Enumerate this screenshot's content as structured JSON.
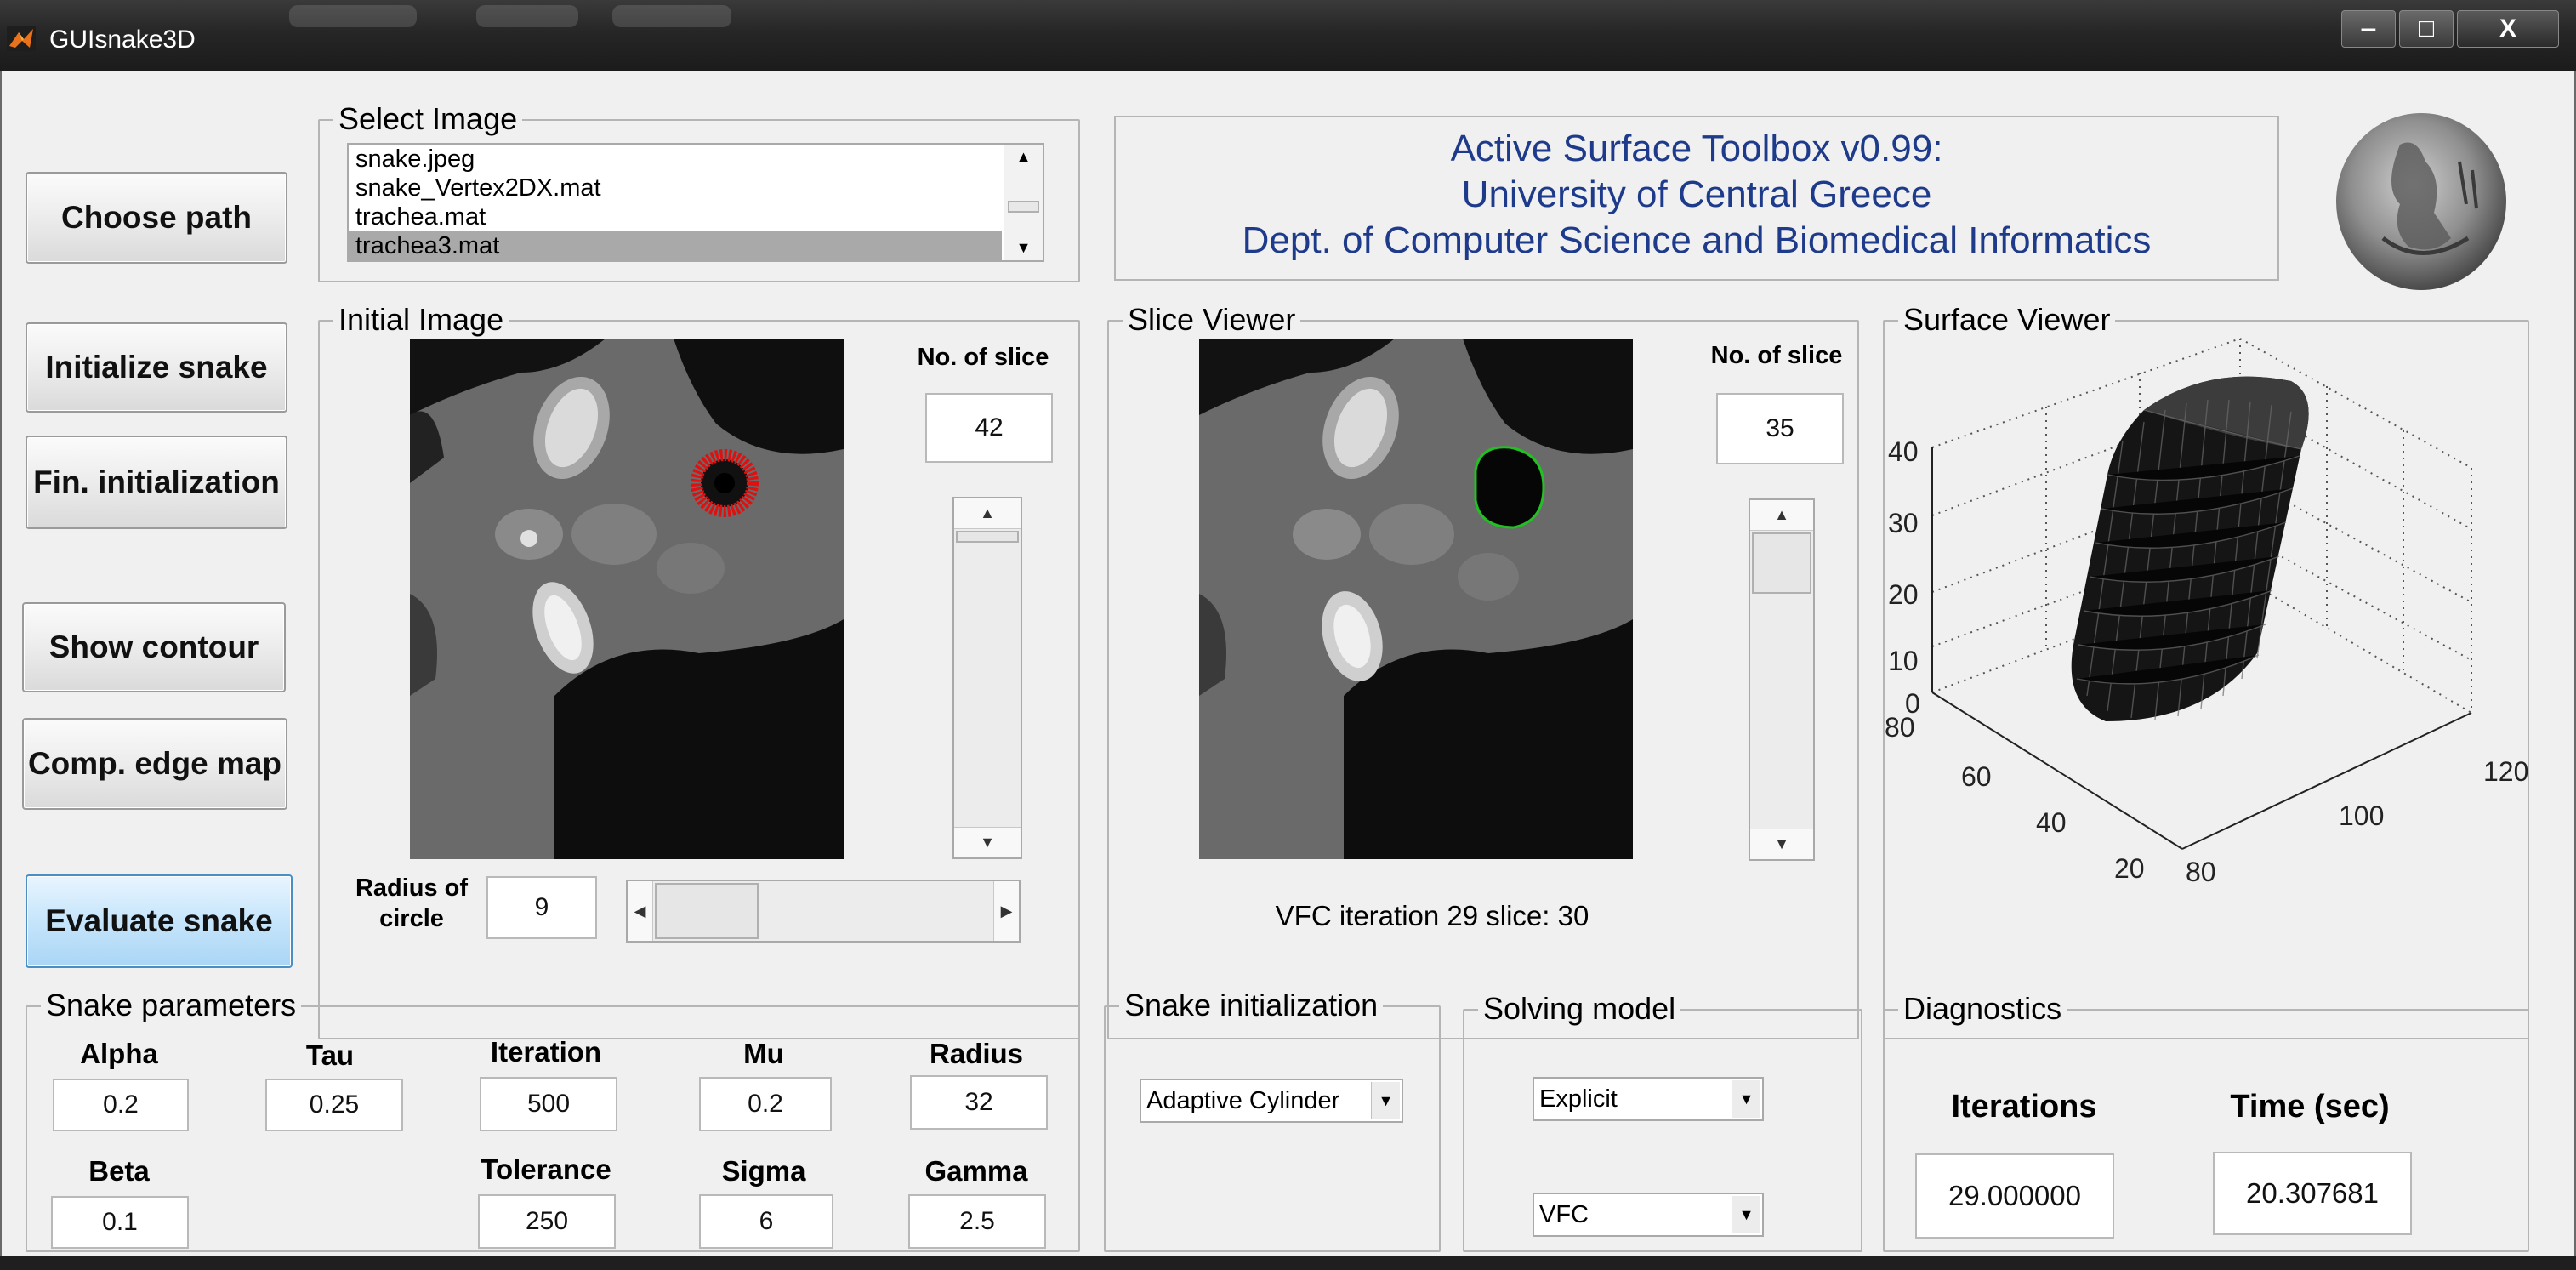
{
  "window": {
    "title": "GUIsnake3D",
    "minimize_glyph": "‒",
    "maximize_glyph": "□",
    "close_glyph": "X"
  },
  "buttons": {
    "choose_path": "Choose path",
    "initialize_snake": "Initialize snake",
    "fin_initialization": "Fin. initialization",
    "show_contour": "Show contour",
    "comp_edge_map": "Comp. edge map",
    "evaluate_snake": "Evaluate snake"
  },
  "select_image": {
    "legend": "Select Image",
    "files": [
      "snake.jpeg",
      "snake_Vertex2DX.mat",
      "trachea.mat",
      "trachea3.mat"
    ],
    "selected": "trachea3.mat"
  },
  "header": {
    "line1": "Active Surface Toolbox v0.99:",
    "line2": "University of Central Greece",
    "line3": "Dept. of Computer Science and Biomedical Informatics",
    "text_color": "#1e3a8a"
  },
  "initial_image": {
    "legend": "Initial Image",
    "slice_label": "No. of slice",
    "slice_value": "42",
    "radius_label_1": "Radius of",
    "radius_label_2": "circle",
    "radius_value": "9",
    "contour_color": "#e01010"
  },
  "slice_viewer": {
    "legend": "Slice Viewer",
    "slice_label": "No. of slice",
    "slice_value": "35",
    "status": "VFC iteration 29 slice: 30",
    "contour_color": "#22c022"
  },
  "surface_viewer": {
    "legend": "Surface Viewer",
    "z_ticks": [
      "40",
      "30",
      "20",
      "10",
      "0"
    ],
    "y_ticks": [
      "80",
      "60",
      "40",
      "20"
    ],
    "x_ticks": [
      "80",
      "100",
      "120"
    ]
  },
  "snake_parameters": {
    "legend": "Snake parameters",
    "alpha_label": "Alpha",
    "alpha": "0.2",
    "tau_label": "Tau",
    "tau": "0.25",
    "iteration_label": "Iteration",
    "iteration": "500",
    "mu_label": "Mu",
    "mu": "0.2",
    "radius_label": "Radius",
    "radius": "32",
    "beta_label": "Beta",
    "beta": "0.1",
    "tolerance_label": "Tolerance",
    "tolerance": "250",
    "sigma_label": "Sigma",
    "sigma": "6",
    "gamma_label": "Gamma",
    "gamma": "2.5"
  },
  "snake_initialization": {
    "legend": "Snake initialization",
    "selected": "Adaptive Cylinder"
  },
  "solving_model": {
    "legend": "Solving model",
    "model": "Explicit",
    "force": "VFC"
  },
  "diagnostics": {
    "legend": "Diagnostics",
    "iterations_label": "Iterations",
    "iterations_value": "29.000000",
    "time_label": "Time (sec)",
    "time_value": "20.307681"
  },
  "colors": {
    "panel_bg": "#f0f0f0",
    "active_button": "#a9d6f5"
  }
}
